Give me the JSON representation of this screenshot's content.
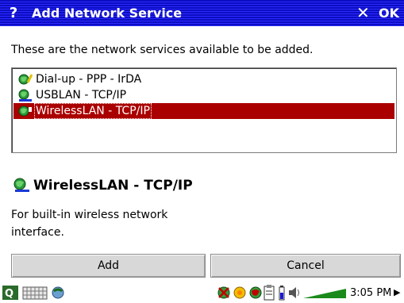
{
  "window": {
    "title": "Add Network Service",
    "help_label": "?",
    "close_label": "✕",
    "ok_label": "OK"
  },
  "dialog": {
    "intro_text": "These are the network services available to be added.",
    "services": [
      {
        "label": "Dial-up - PPP - IrDA",
        "icon": "dialup-network-icon",
        "selected": false
      },
      {
        "label": "USBLAN - TCP/IP",
        "icon": "usb-network-icon",
        "selected": false
      },
      {
        "label": "WirelessLAN - TCP/IP",
        "icon": "wireless-network-icon",
        "selected": true
      }
    ],
    "detail": {
      "title": "WirelessLAN - TCP/IP",
      "description": "For built-in wireless network interface."
    },
    "buttons": {
      "add_label": "Add",
      "cancel_label": "Cancel"
    }
  },
  "taskbar": {
    "clock": "3:05 PM",
    "more_arrow": "▶"
  },
  "colors": {
    "titlebar": "#1a1ad8",
    "selection": "#aa0000",
    "button_face": "#d8d8d8"
  }
}
